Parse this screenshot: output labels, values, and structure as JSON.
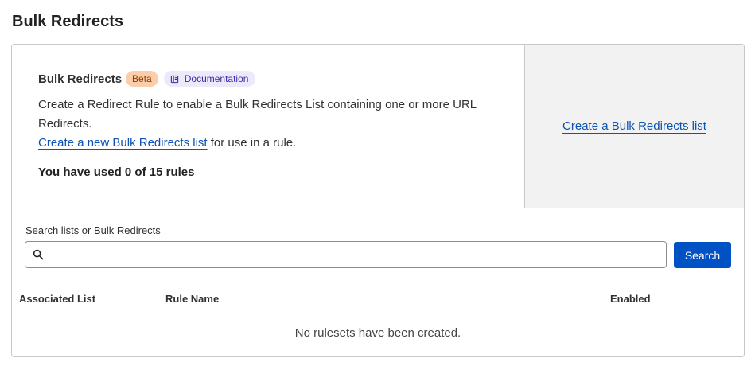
{
  "page": {
    "title": "Bulk Redirects"
  },
  "info": {
    "title": "Bulk Redirects",
    "badge": "Beta",
    "doc_label": "Documentation",
    "description": "Create a Redirect Rule to enable a Bulk Redirects List containing one or more URL Redirects.",
    "create_link": "Create a new Bulk Redirects list",
    "create_suffix": " for use in a rule.",
    "usage": "You have used 0 of 15 rules"
  },
  "side": {
    "link": "Create a Bulk Redirects list"
  },
  "search": {
    "label": "Search lists or Bulk Redirects",
    "value": "",
    "placeholder": "",
    "button": "Search"
  },
  "table": {
    "columns": [
      "Associated List",
      "Rule Name",
      "Enabled"
    ],
    "empty_message": "No rulesets have been created."
  },
  "colors": {
    "primary": "#0051c3",
    "link": "#0b53b5",
    "beta_bg": "#fbcda9",
    "doc_bg": "#ece9fb"
  },
  "icons": {
    "doc": "book-icon",
    "search": "search-icon"
  }
}
